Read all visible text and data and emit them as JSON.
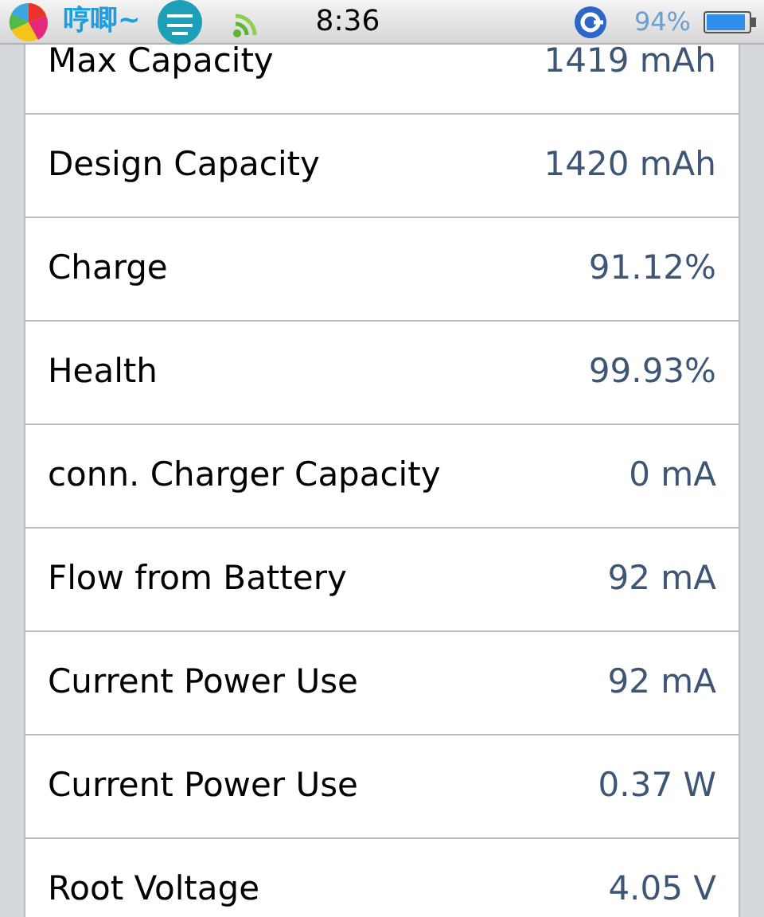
{
  "status_bar": {
    "app_text": "哼唧~",
    "time": "8:36",
    "battery_percent": "94%"
  },
  "rows": [
    {
      "label": "Max Capacity",
      "value": "1419 mAh"
    },
    {
      "label": "Design Capacity",
      "value": "1420 mAh"
    },
    {
      "label": "Charge",
      "value": "91.12%"
    },
    {
      "label": "Health",
      "value": "99.93%"
    },
    {
      "label": "conn. Charger Capacity",
      "value": "0 mA"
    },
    {
      "label": "Flow from Battery",
      "value": "92 mA"
    },
    {
      "label": "Current Power Use",
      "value": "92 mA"
    },
    {
      "label": "Current Power Use",
      "value": "0.37 W"
    },
    {
      "label": "Root Voltage",
      "value": "4.05 V"
    }
  ]
}
